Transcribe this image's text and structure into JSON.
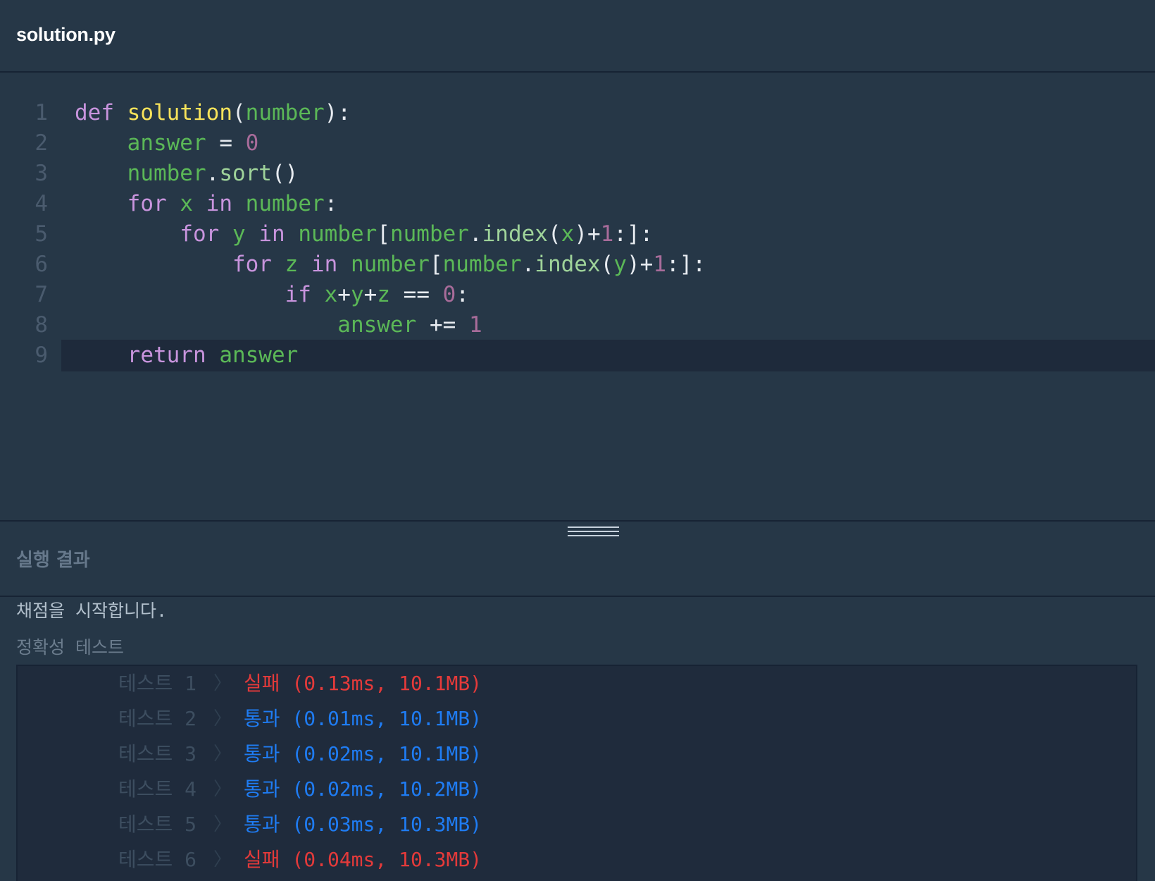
{
  "header": {
    "file_name": "solution.py"
  },
  "editor": {
    "active_line": 9,
    "lines": [
      {
        "number": "1",
        "code": "def solution(number):"
      },
      {
        "number": "2",
        "code": "    answer = 0"
      },
      {
        "number": "3",
        "code": "    number.sort()"
      },
      {
        "number": "4",
        "code": "    for x in number:"
      },
      {
        "number": "5",
        "code": "        for y in number[number.index(x)+1:]:"
      },
      {
        "number": "6",
        "code": "            for z in number[number.index(y)+1:]:"
      },
      {
        "number": "7",
        "code": "                if x+y+z == 0:"
      },
      {
        "number": "8",
        "code": "                    answer += 1"
      },
      {
        "number": "9",
        "code": "    return answer"
      }
    ]
  },
  "results": {
    "title": "실행 결과",
    "grading_message": "채점을 시작합니다.",
    "section_label": "정확성  테스트",
    "tests": [
      {
        "name": "테스트 1",
        "status": "실패",
        "detail": "(0.13ms, 10.1MB)",
        "passed": false
      },
      {
        "name": "테스트 2",
        "status": "통과",
        "detail": "(0.01ms, 10.1MB)",
        "passed": true
      },
      {
        "name": "테스트 3",
        "status": "통과",
        "detail": "(0.02ms, 10.1MB)",
        "passed": true
      },
      {
        "name": "테스트 4",
        "status": "통과",
        "detail": "(0.02ms, 10.2MB)",
        "passed": true
      },
      {
        "name": "테스트 5",
        "status": "통과",
        "detail": "(0.03ms, 10.3MB)",
        "passed": true
      },
      {
        "name": "테스트 6",
        "status": "실패",
        "detail": "(0.04ms, 10.3MB)",
        "passed": false
      }
    ]
  },
  "colors": {
    "background": "#263747",
    "editor_active_line": "#1e2a3b",
    "keyword": "#c894dd",
    "function": "#f8e35a",
    "variable": "#5bb857",
    "number": "#a86c9a",
    "fail": "#e43a3a",
    "pass": "#1f7cf3"
  }
}
